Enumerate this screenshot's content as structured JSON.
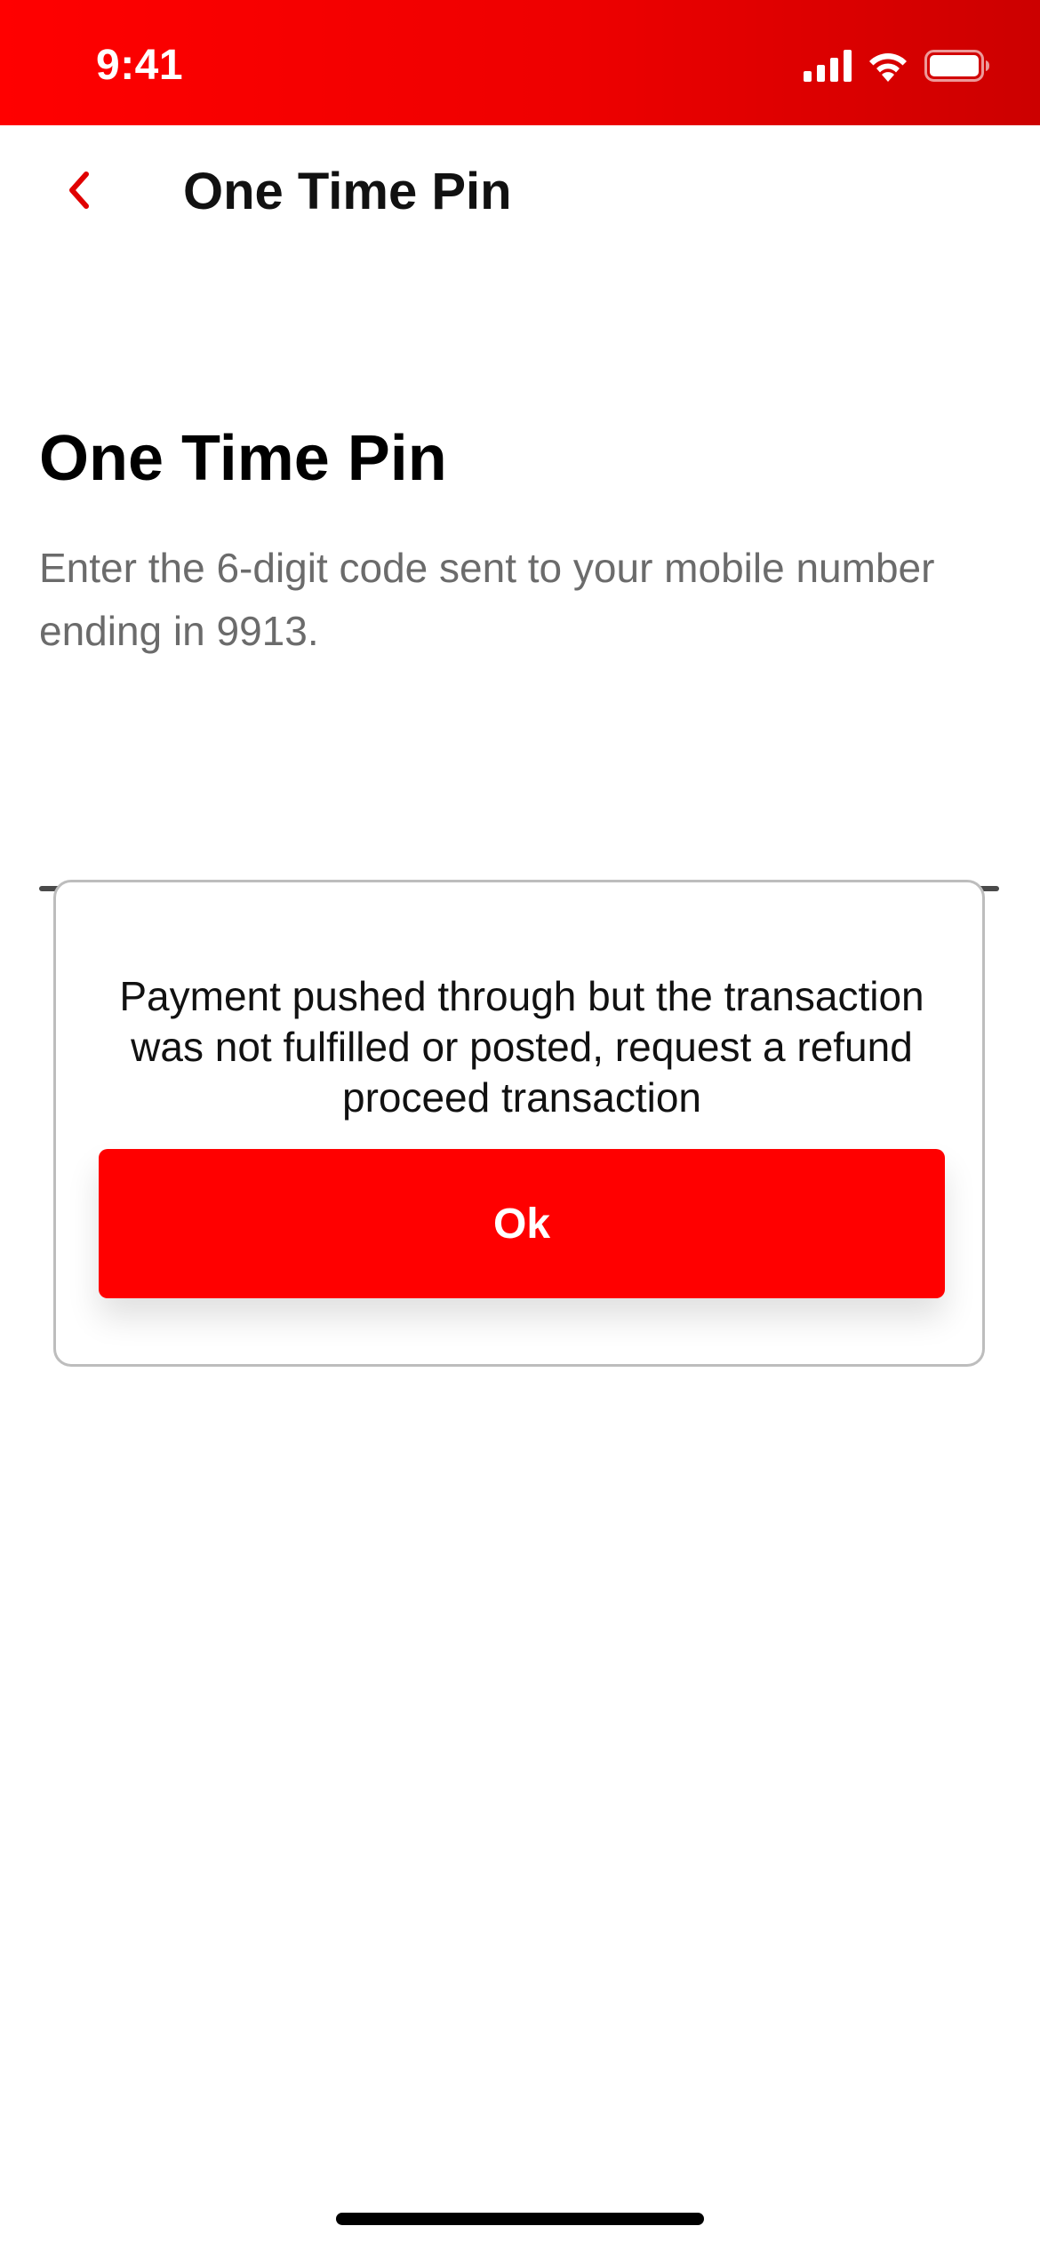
{
  "status_bar": {
    "time": "9:41",
    "icons": [
      "cellular-signal-icon",
      "wifi-icon",
      "battery-icon"
    ],
    "background": "#ff0000"
  },
  "nav": {
    "back_icon": "chevron-left-icon",
    "title": "One Time Pin"
  },
  "main": {
    "title": "One Time Pin",
    "subtitle": "Enter the 6-digit code sent to your mobile number ending in 9913."
  },
  "dialog": {
    "message": "Payment pushed through but the transaction was not fulfilled or posted, request a refund proceed transaction",
    "ok_label": "Ok"
  },
  "colors": {
    "brand_red": "#ff0000",
    "text_secondary": "#6b6b6b"
  }
}
